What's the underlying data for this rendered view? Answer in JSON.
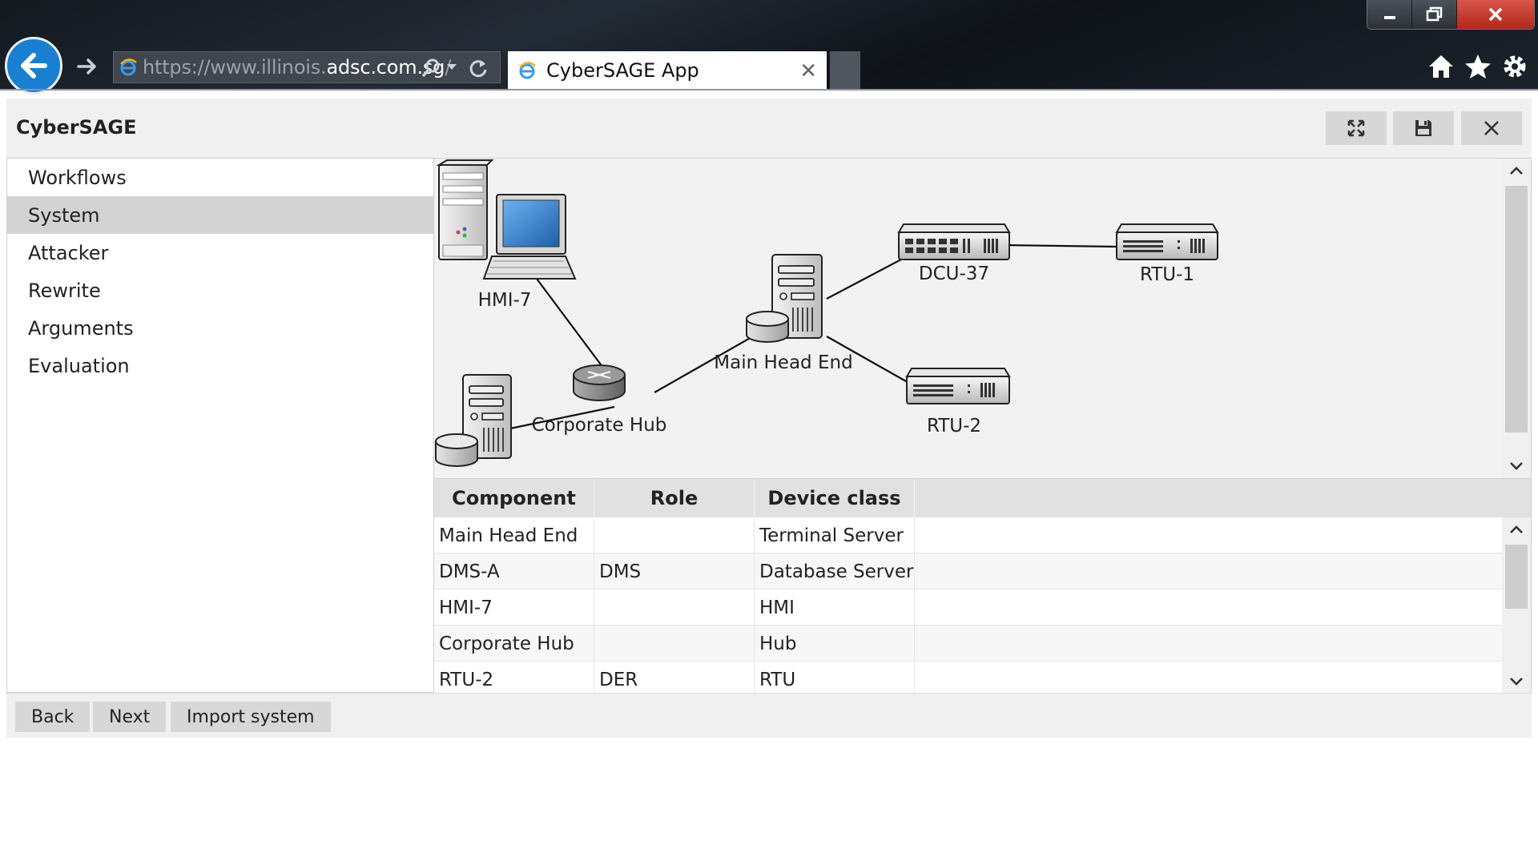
{
  "browser": {
    "url_prefix": "https://www.illinois.",
    "url_domain": "adsc.com.sg",
    "url_suffix": "/",
    "tab_title": "CyberSAGE App"
  },
  "app": {
    "title": "CyberSAGE",
    "header_buttons": [
      "fullscreen",
      "save",
      "close"
    ]
  },
  "sidebar": {
    "items": [
      {
        "label": "Workflows",
        "active": false
      },
      {
        "label": "System",
        "active": true
      },
      {
        "label": "Attacker",
        "active": false
      },
      {
        "label": "Rewrite",
        "active": false
      },
      {
        "label": "Arguments",
        "active": false
      },
      {
        "label": "Evaluation",
        "active": false
      }
    ]
  },
  "diagram": {
    "nodes": {
      "hmi7": {
        "label": "HMI-7",
        "icon": "workstation-icon"
      },
      "hub": {
        "label": "Corporate Hub",
        "icon": "router-icon"
      },
      "headend": {
        "label": "Main Head End",
        "icon": "server-with-db-icon"
      },
      "dcu37": {
        "label": "DCU-37",
        "icon": "switch-icon"
      },
      "rtu1": {
        "label": "RTU-1",
        "icon": "switch-icon"
      },
      "rtu2": {
        "label": "RTU-2",
        "icon": "switch-icon"
      },
      "dms": {
        "label": "",
        "icon": "server-with-db-icon"
      }
    }
  },
  "table": {
    "headers": [
      "Component",
      "Role",
      "Device class"
    ],
    "rows": [
      [
        "Main Head End",
        "",
        "Terminal Server"
      ],
      [
        "DMS-A",
        "DMS",
        "Database Server"
      ],
      [
        "HMI-7",
        "",
        "HMI"
      ],
      [
        "Corporate Hub",
        "",
        "Hub"
      ],
      [
        "RTU-2",
        "DER",
        "RTU"
      ]
    ]
  },
  "footer": {
    "back": "Back",
    "next": "Next",
    "import": "Import system"
  }
}
